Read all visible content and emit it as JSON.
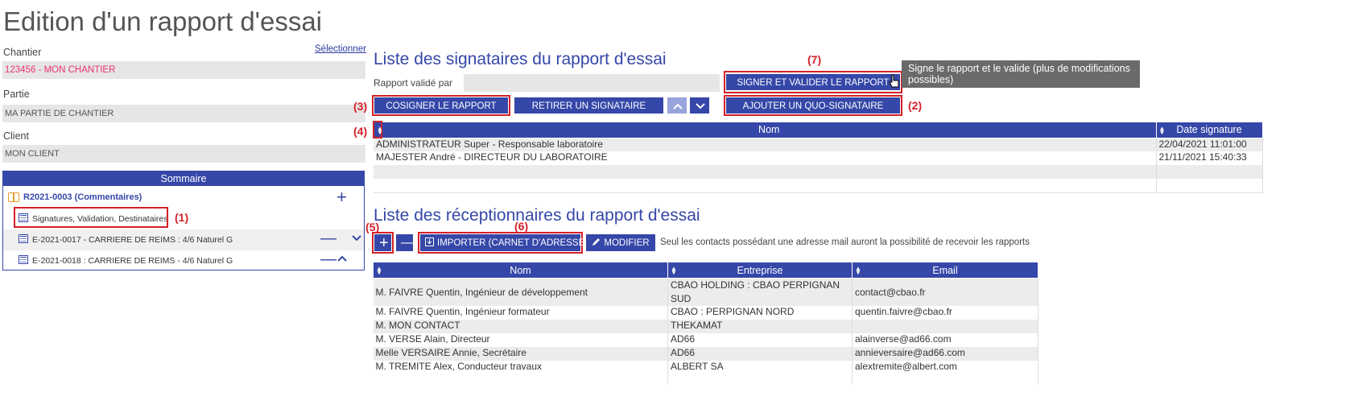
{
  "title": "Edition d'un rapport d'essai",
  "left": {
    "chantier_label": "Chantier",
    "select_link": "Sélectionner",
    "chantier_value": "123456 - MON CHANTIER",
    "partie_label": "Partie",
    "partie_value": "MA PARTIE DE CHANTIER",
    "client_label": "Client",
    "client_value": "MON CLIENT"
  },
  "sommaire": {
    "title": "Sommaire",
    "root_label": "R2021-0003 (Commentaires)",
    "items": [
      {
        "label": "Signatures, Validation, Destinataires"
      },
      {
        "label": "E-2021-0017 - CARRIERE DE REIMS : 4/6 Naturel G"
      },
      {
        "label": "E-2021-0018 : CARRIERE DE REIMS - 4/6 Naturel G"
      }
    ]
  },
  "annotations": {
    "a1": "(1)",
    "a2": "(2)",
    "a3": "(3)",
    "a4": "(4)",
    "a5": "(5)",
    "a6": "(6)",
    "a7": "(7)"
  },
  "signataires": {
    "title": "Liste des signataires du rapport d'essai",
    "validated_by_label": "Rapport validé par",
    "validated_by_value": "",
    "sign_validate_button": "SIGNER ET VALIDER LE RAPPORT",
    "tooltip": "Signe le rapport et le valide (plus de modifications possibles)",
    "cosign_button": "COSIGNER LE RAPPORT",
    "remove_button": "RETIRER UN SIGNATAIRE",
    "add_quo_button": "AJOUTER UN QUO-SIGNATAIRE",
    "columns": [
      "Nom",
      "Date signature"
    ],
    "rows": [
      {
        "nom": "ADMINISTRATEUR Super - Responsable laboratoire",
        "date": "22/04/2021 11:01:00"
      },
      {
        "nom": "MAJESTER André - DIRECTEUR DU LABORATOIRE",
        "date": "21/11/2021 15:40:33"
      }
    ]
  },
  "receptionnaires": {
    "title": "Liste des réceptionnaires du rapport d'essai",
    "import_button": "IMPORTER (CARNET D'ADRESSE)",
    "modify_button": "MODIFIER",
    "note": "Seul les contacts possédant une adresse mail auront la possibilité de recevoir les rapports",
    "columns": [
      "Nom",
      "Entreprise",
      "Email"
    ],
    "rows": [
      {
        "nom": "M. FAIVRE Quentin, Ingénieur de développement",
        "entreprise": "CBAO HOLDING : CBAO PERPIGNAN SUD",
        "email": "contact@cbao.fr"
      },
      {
        "nom": "M. FAIVRE Quentin, Ingénieur formateur",
        "entreprise": "CBAO : PERPIGNAN NORD",
        "email": "quentin.faivre@cbao.fr"
      },
      {
        "nom": "M. MON CONTACT",
        "entreprise": "THEKAMAT",
        "email": ""
      },
      {
        "nom": "M. VERSE Alain, Directeur",
        "entreprise": "AD66",
        "email": "alainverse@ad66.com"
      },
      {
        "nom": "Melle VERSAIRE Annie, Secrétaire",
        "entreprise": "AD66",
        "email": "annieversaire@ad66.com"
      },
      {
        "nom": "M. TREMITE Alex, Conducteur travaux",
        "entreprise": "ALBERT SA",
        "email": "alextremite@albert.com"
      }
    ]
  },
  "colors": {
    "primary": "#3547a8",
    "annotation": "#d42027",
    "accent_text": "#e8346a"
  }
}
